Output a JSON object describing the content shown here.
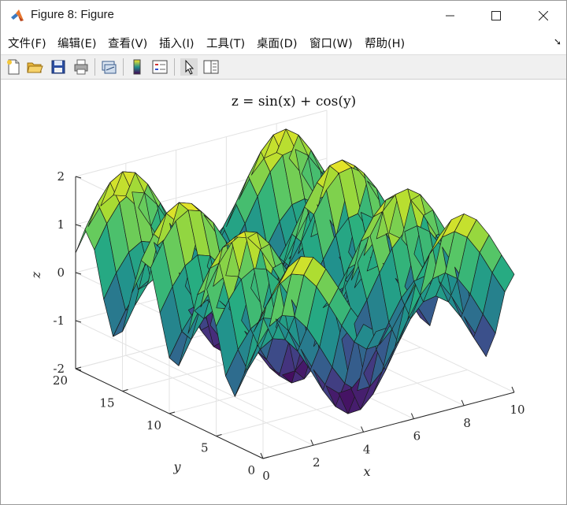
{
  "window": {
    "title": "Figure 8: Figure"
  },
  "menu": {
    "items": [
      "文件(F)",
      "编辑(E)",
      "查看(V)",
      "插入(I)",
      "工具(T)",
      "桌面(D)",
      "窗口(W)",
      "帮助(H)"
    ],
    "overflow_icon": "dock-arrow-icon"
  },
  "toolbar": {
    "buttons": [
      {
        "name": "new-figure-button",
        "icon": "new-file-icon"
      },
      {
        "name": "open-file-button",
        "icon": "open-folder-icon"
      },
      {
        "name": "save-figure-button",
        "icon": "save-disk-icon"
      },
      {
        "name": "print-figure-button",
        "icon": "printer-icon"
      },
      {
        "name": "link-plot-button",
        "icon": "link-plot-icon"
      },
      {
        "name": "insert-colorbar-button",
        "icon": "colorbar-icon"
      },
      {
        "name": "insert-legend-button",
        "icon": "legend-icon"
      },
      {
        "name": "edit-plot-button",
        "icon": "pointer-arrow-icon"
      },
      {
        "name": "property-inspector-button",
        "icon": "property-panel-icon"
      }
    ]
  },
  "chart_data": {
    "type": "surface",
    "title": "z = sin(x) + cos(y)",
    "xlabel": "x",
    "ylabel": "y",
    "zlabel": "z",
    "xlim": [
      0,
      10
    ],
    "ylim": [
      0,
      20
    ],
    "zlim": [
      -2,
      2
    ],
    "xticks": [
      "0",
      "2",
      "4",
      "6",
      "8",
      "10"
    ],
    "yticks": [
      "0",
      "5",
      "10",
      "15",
      "20"
    ],
    "zticks": [
      "-2",
      "-1",
      "0",
      "1",
      "2"
    ],
    "grid": true,
    "colormap": "viridis",
    "x_step": 0.5,
    "y_step": 1,
    "function": "sin(x) + cos(y)"
  }
}
